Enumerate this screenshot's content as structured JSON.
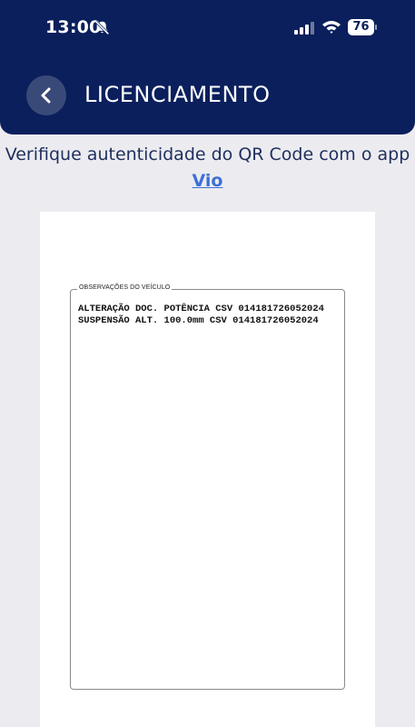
{
  "status_bar": {
    "time": "13:00",
    "battery": "76",
    "icons": [
      "bell-slash-icon",
      "signal-icon",
      "wifi-icon",
      "battery-icon"
    ]
  },
  "header": {
    "back_icon": "chevron-left-icon",
    "title": "LICENCIAMENTO"
  },
  "verify": {
    "text": "Verifique autenticidade do QR Code com o app ",
    "link": "Vio"
  },
  "document": {
    "observations_label": "OBSERVAÇÕES DO VEÍCULO",
    "observations": [
      "ALTERAÇÃO DOC. POTÊNCIA CSV 014181726052024",
      "SUSPENSÃO ALT. 100.0mm CSV 014181726052024"
    ]
  },
  "colors": {
    "header_bg": "#0a1f5c",
    "page_bg": "#ececf0",
    "link": "#3d6fd6",
    "text": "#1f2f5e"
  }
}
